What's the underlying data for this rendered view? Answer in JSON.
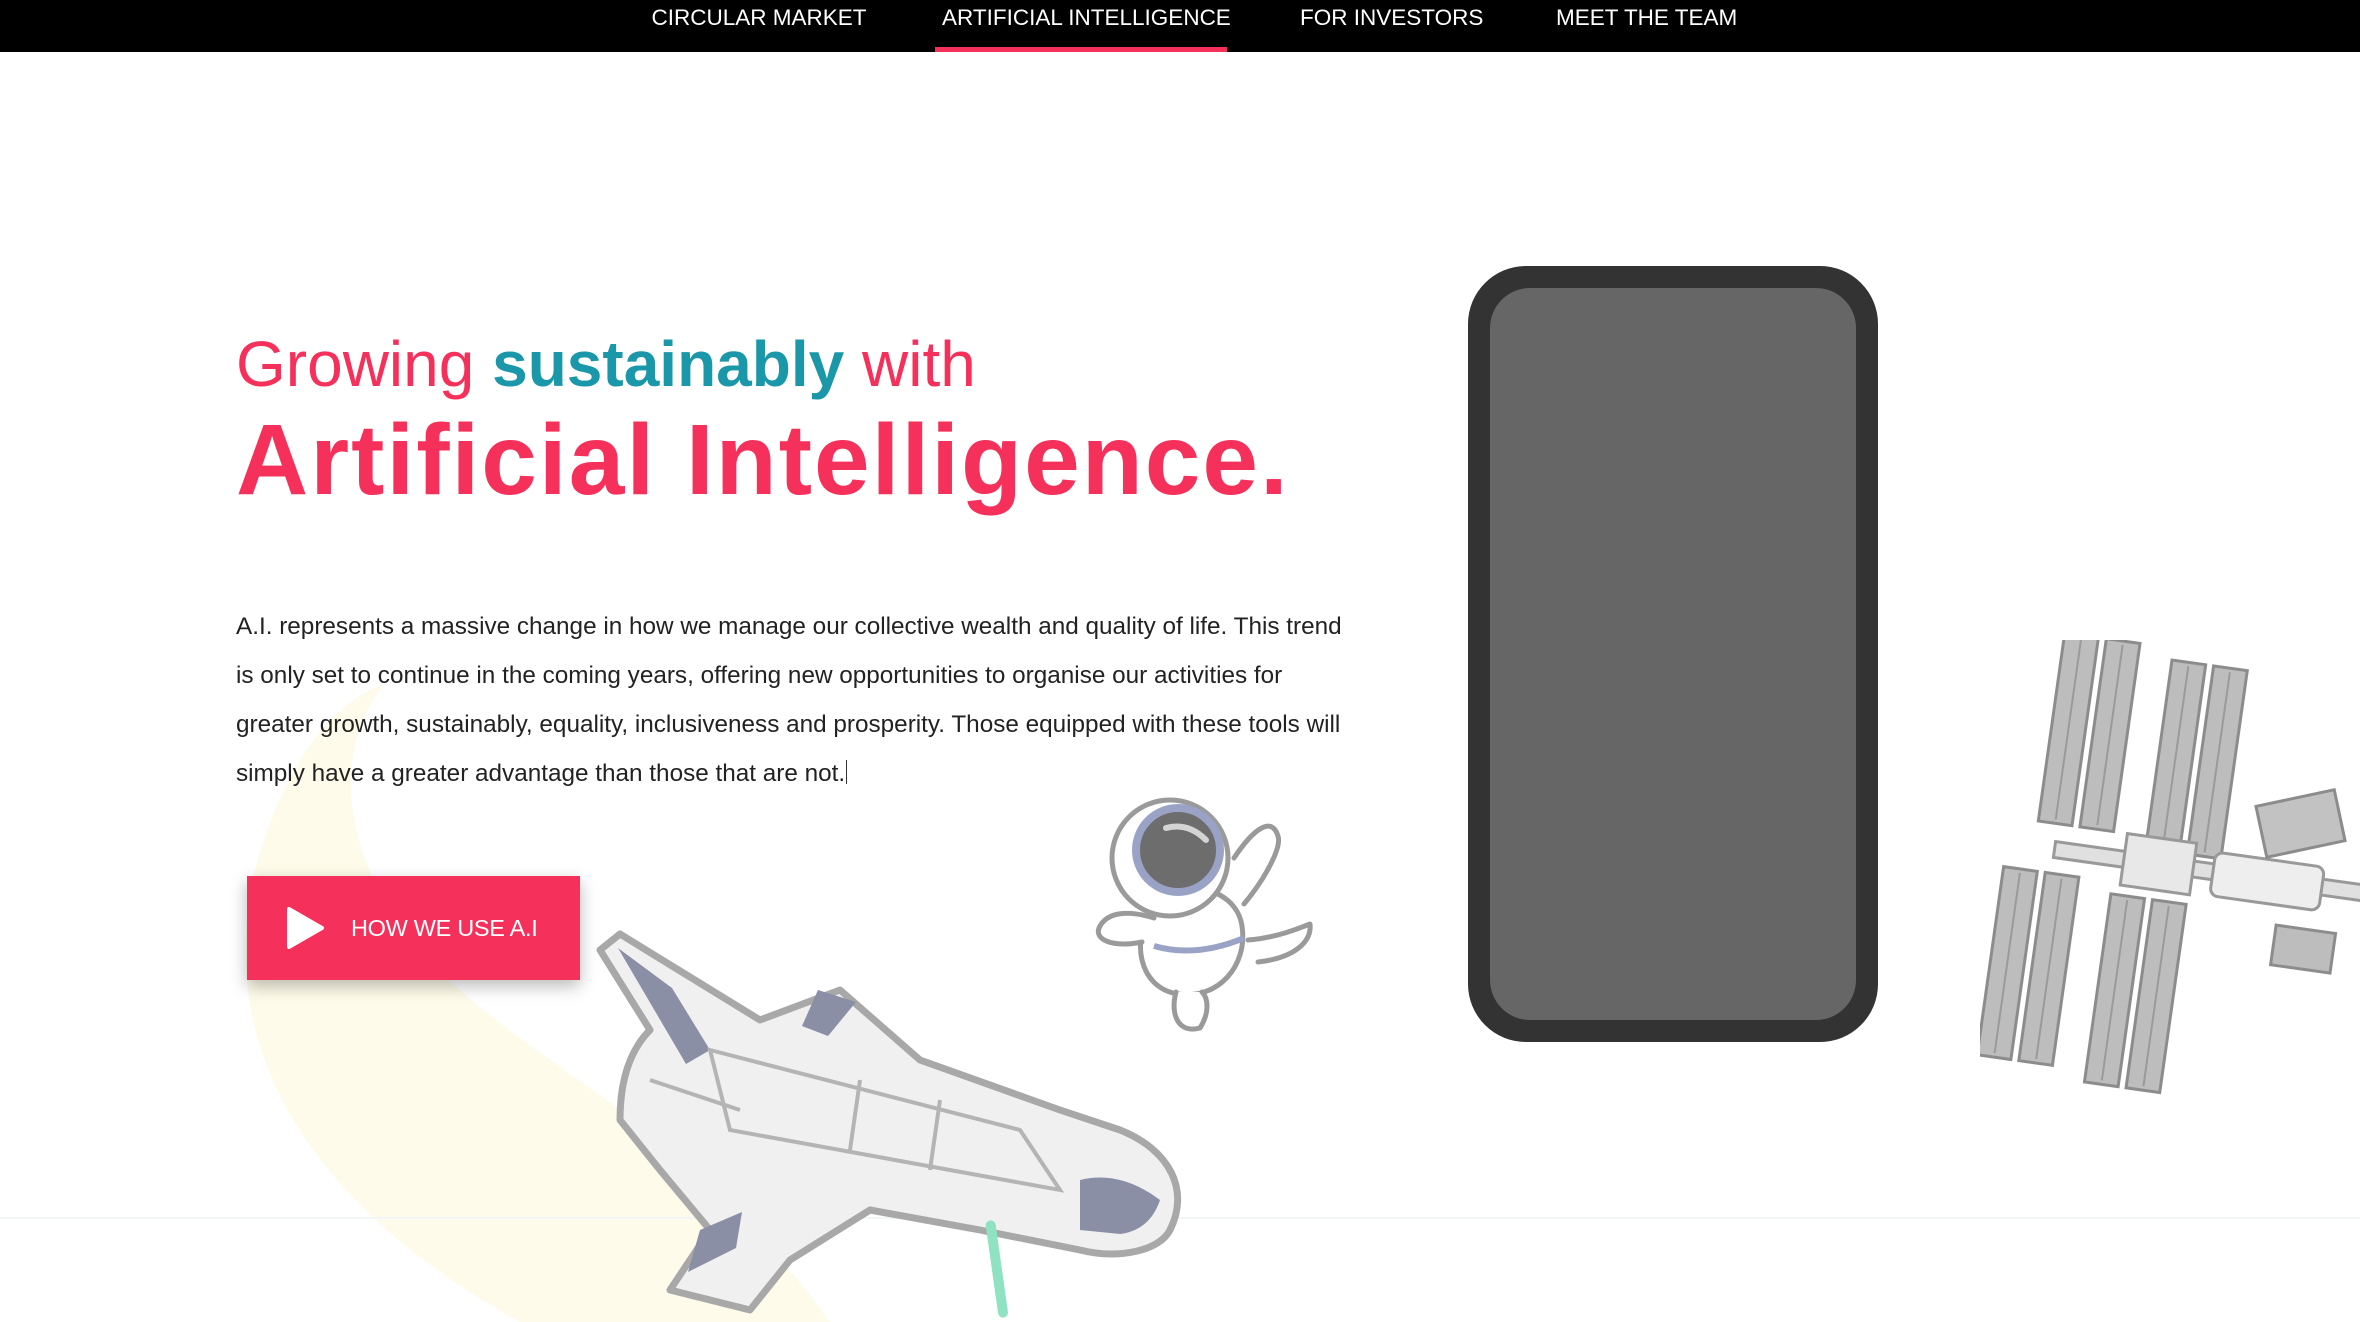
{
  "nav": {
    "items": [
      {
        "label": "CIRCULAR MARKET"
      },
      {
        "label": "ARTIFICIAL INTELLIGENCE",
        "active": true
      },
      {
        "label": "FOR INVESTORS"
      },
      {
        "label": "MEET THE TEAM"
      }
    ]
  },
  "hero": {
    "line1_prefix": "Growing ",
    "line1_accent": "sustainably",
    "line1_suffix": " with",
    "title": "Artificial Intelligence.",
    "description": "A.I. represents a massive change in how we manage our collective wealth and quality of life. This trend is only set to continue in the coming years, offering new opportunities to organise our activities for greater growth, sustainably, equality, inclusiveness and prosperity. Those equipped with these tools will simply have a greater advantage than those that are not.",
    "cta_label": "HOW WE USE A.I",
    "cta_icon": "play-icon"
  },
  "illustrations": [
    "phone-mockup",
    "astronaut",
    "space-shuttle",
    "space-station"
  ],
  "colors": {
    "accent": "#f5305a",
    "teal": "#1a97a8",
    "nav_background": "#000000",
    "phone_frame": "#333333",
    "phone_screen": "#666666"
  }
}
